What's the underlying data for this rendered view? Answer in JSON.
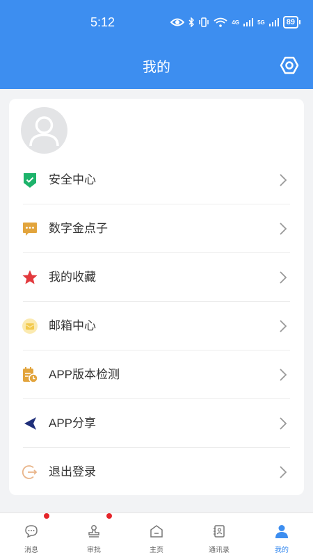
{
  "status_bar": {
    "time": "5:12",
    "net_4g": "4G",
    "net_5g": "5G",
    "battery": "89"
  },
  "header": {
    "title": "我的"
  },
  "menu": {
    "items": [
      {
        "label": "安全中心",
        "icon": "shield-check-icon"
      },
      {
        "label": "数字金点子",
        "icon": "chat-bubble-icon"
      },
      {
        "label": "我的收藏",
        "icon": "star-icon"
      },
      {
        "label": "邮箱中心",
        "icon": "mail-icon"
      },
      {
        "label": "APP版本检测",
        "icon": "version-check-icon"
      },
      {
        "label": "APP分享",
        "icon": "share-icon"
      },
      {
        "label": "退出登录",
        "icon": "logout-icon"
      }
    ]
  },
  "tabbar": {
    "items": [
      {
        "label": "消息",
        "icon": "message-icon",
        "badge": true
      },
      {
        "label": "审批",
        "icon": "stamp-icon",
        "badge": true
      },
      {
        "label": "主页",
        "icon": "home-icon",
        "badge": false
      },
      {
        "label": "通讯录",
        "icon": "contacts-icon",
        "badge": false
      },
      {
        "label": "我的",
        "icon": "person-icon",
        "badge": false,
        "active": true
      }
    ]
  },
  "colors": {
    "brand": "#3d8ef0",
    "shield": "#1db36b",
    "gold": "#e2a43c",
    "star": "#e2393d",
    "mail": "#f2c94c",
    "share": "#1f2f7a",
    "logout": "#e9b58a",
    "badge": "#e5252a"
  }
}
